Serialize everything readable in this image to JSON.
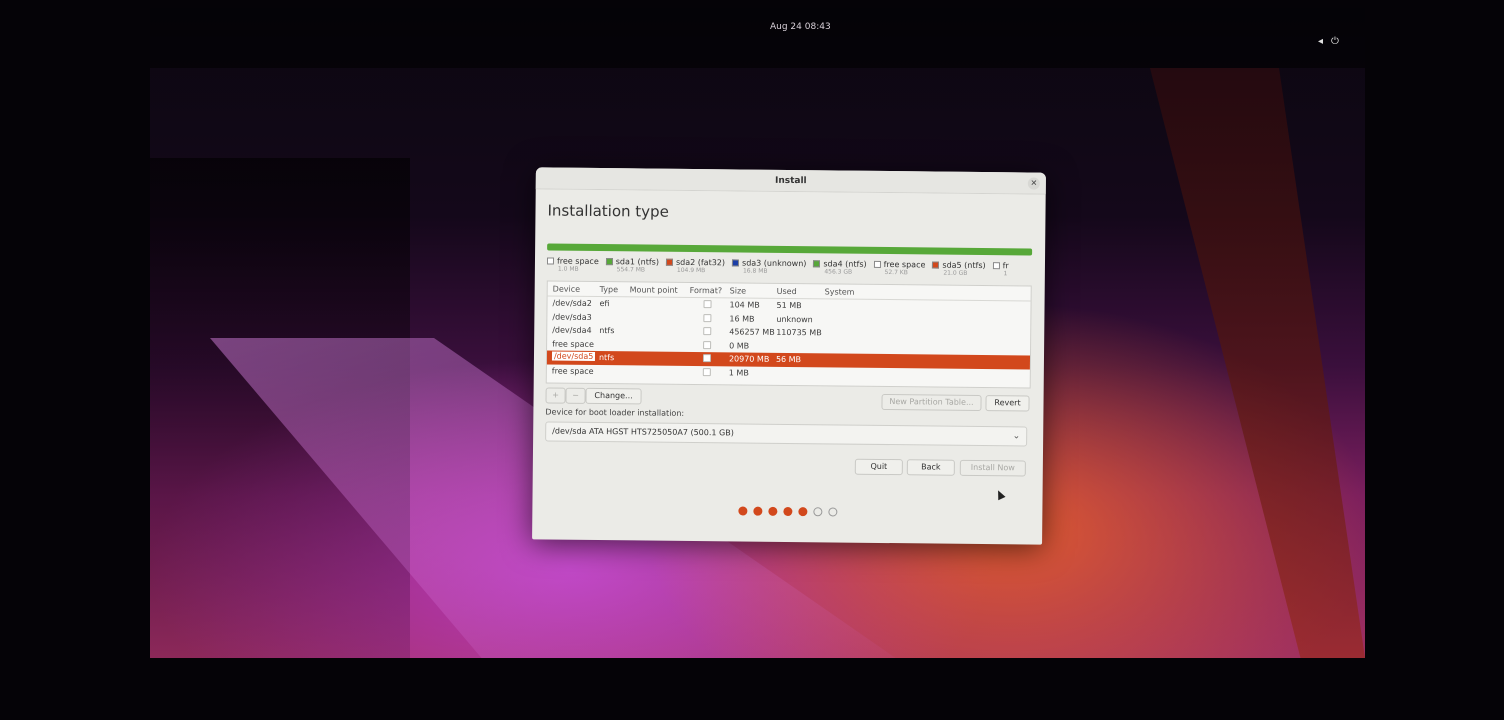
{
  "topbar": {
    "clock": "Aug 24  08:43",
    "icons": [
      "volume-icon",
      "power-icon"
    ]
  },
  "window": {
    "title": "Install",
    "header": "Installation type",
    "legend": [
      {
        "label": "free space",
        "size": "1.0 MB",
        "color": "#ffffff"
      },
      {
        "label": "sda1 (ntfs)",
        "size": "554.7 MB",
        "color": "#57a839"
      },
      {
        "label": "sda2 (fat32)",
        "size": "104.9 MB",
        "color": "#d2481c"
      },
      {
        "label": "sda3 (unknown)",
        "size": "16.8 MB",
        "color": "#1c3fa8"
      },
      {
        "label": "sda4 (ntfs)",
        "size": "456.3 GB",
        "color": "#57a839"
      },
      {
        "label": "free space",
        "size": "52.7 KB",
        "color": "#ffffff"
      },
      {
        "label": "sda5 (ntfs)",
        "size": "21.0 GB",
        "color": "#d2481c"
      },
      {
        "label": "fr",
        "size": "1",
        "color": "#ffffff"
      }
    ],
    "table": {
      "columns": {
        "device": "Device",
        "type": "Type",
        "mount": "Mount point",
        "format": "Format?",
        "size": "Size",
        "used": "Used",
        "system": "System"
      },
      "rows": [
        {
          "device": "/dev/sda2",
          "type": "efi",
          "size": "104 MB",
          "used": "51 MB"
        },
        {
          "device": "/dev/sda3",
          "type": "",
          "size": "16 MB",
          "used": "unknown"
        },
        {
          "device": "/dev/sda4",
          "type": "ntfs",
          "size": "456257 MB",
          "used": "110735 MB"
        },
        {
          "device": "free space",
          "type": "",
          "size": "0 MB",
          "used": ""
        },
        {
          "device": "/dev/sda5",
          "type": "ntfs",
          "size": "20970 MB",
          "used": "56 MB"
        },
        {
          "device": "free space",
          "type": "",
          "size": "1 MB",
          "used": ""
        }
      ]
    },
    "toolbar": {
      "add": "+",
      "remove": "−",
      "change": "Change...",
      "new_table": "New Partition Table...",
      "revert": "Revert"
    },
    "bootloader": {
      "label": "Device for boot loader installation:",
      "value": "/dev/sda   ATA HGST HTS725050A7 (500.1 GB)"
    },
    "buttons": {
      "quit": "Quit",
      "back": "Back",
      "install": "Install Now"
    },
    "progress": {
      "total": 7,
      "completed": 5
    }
  }
}
